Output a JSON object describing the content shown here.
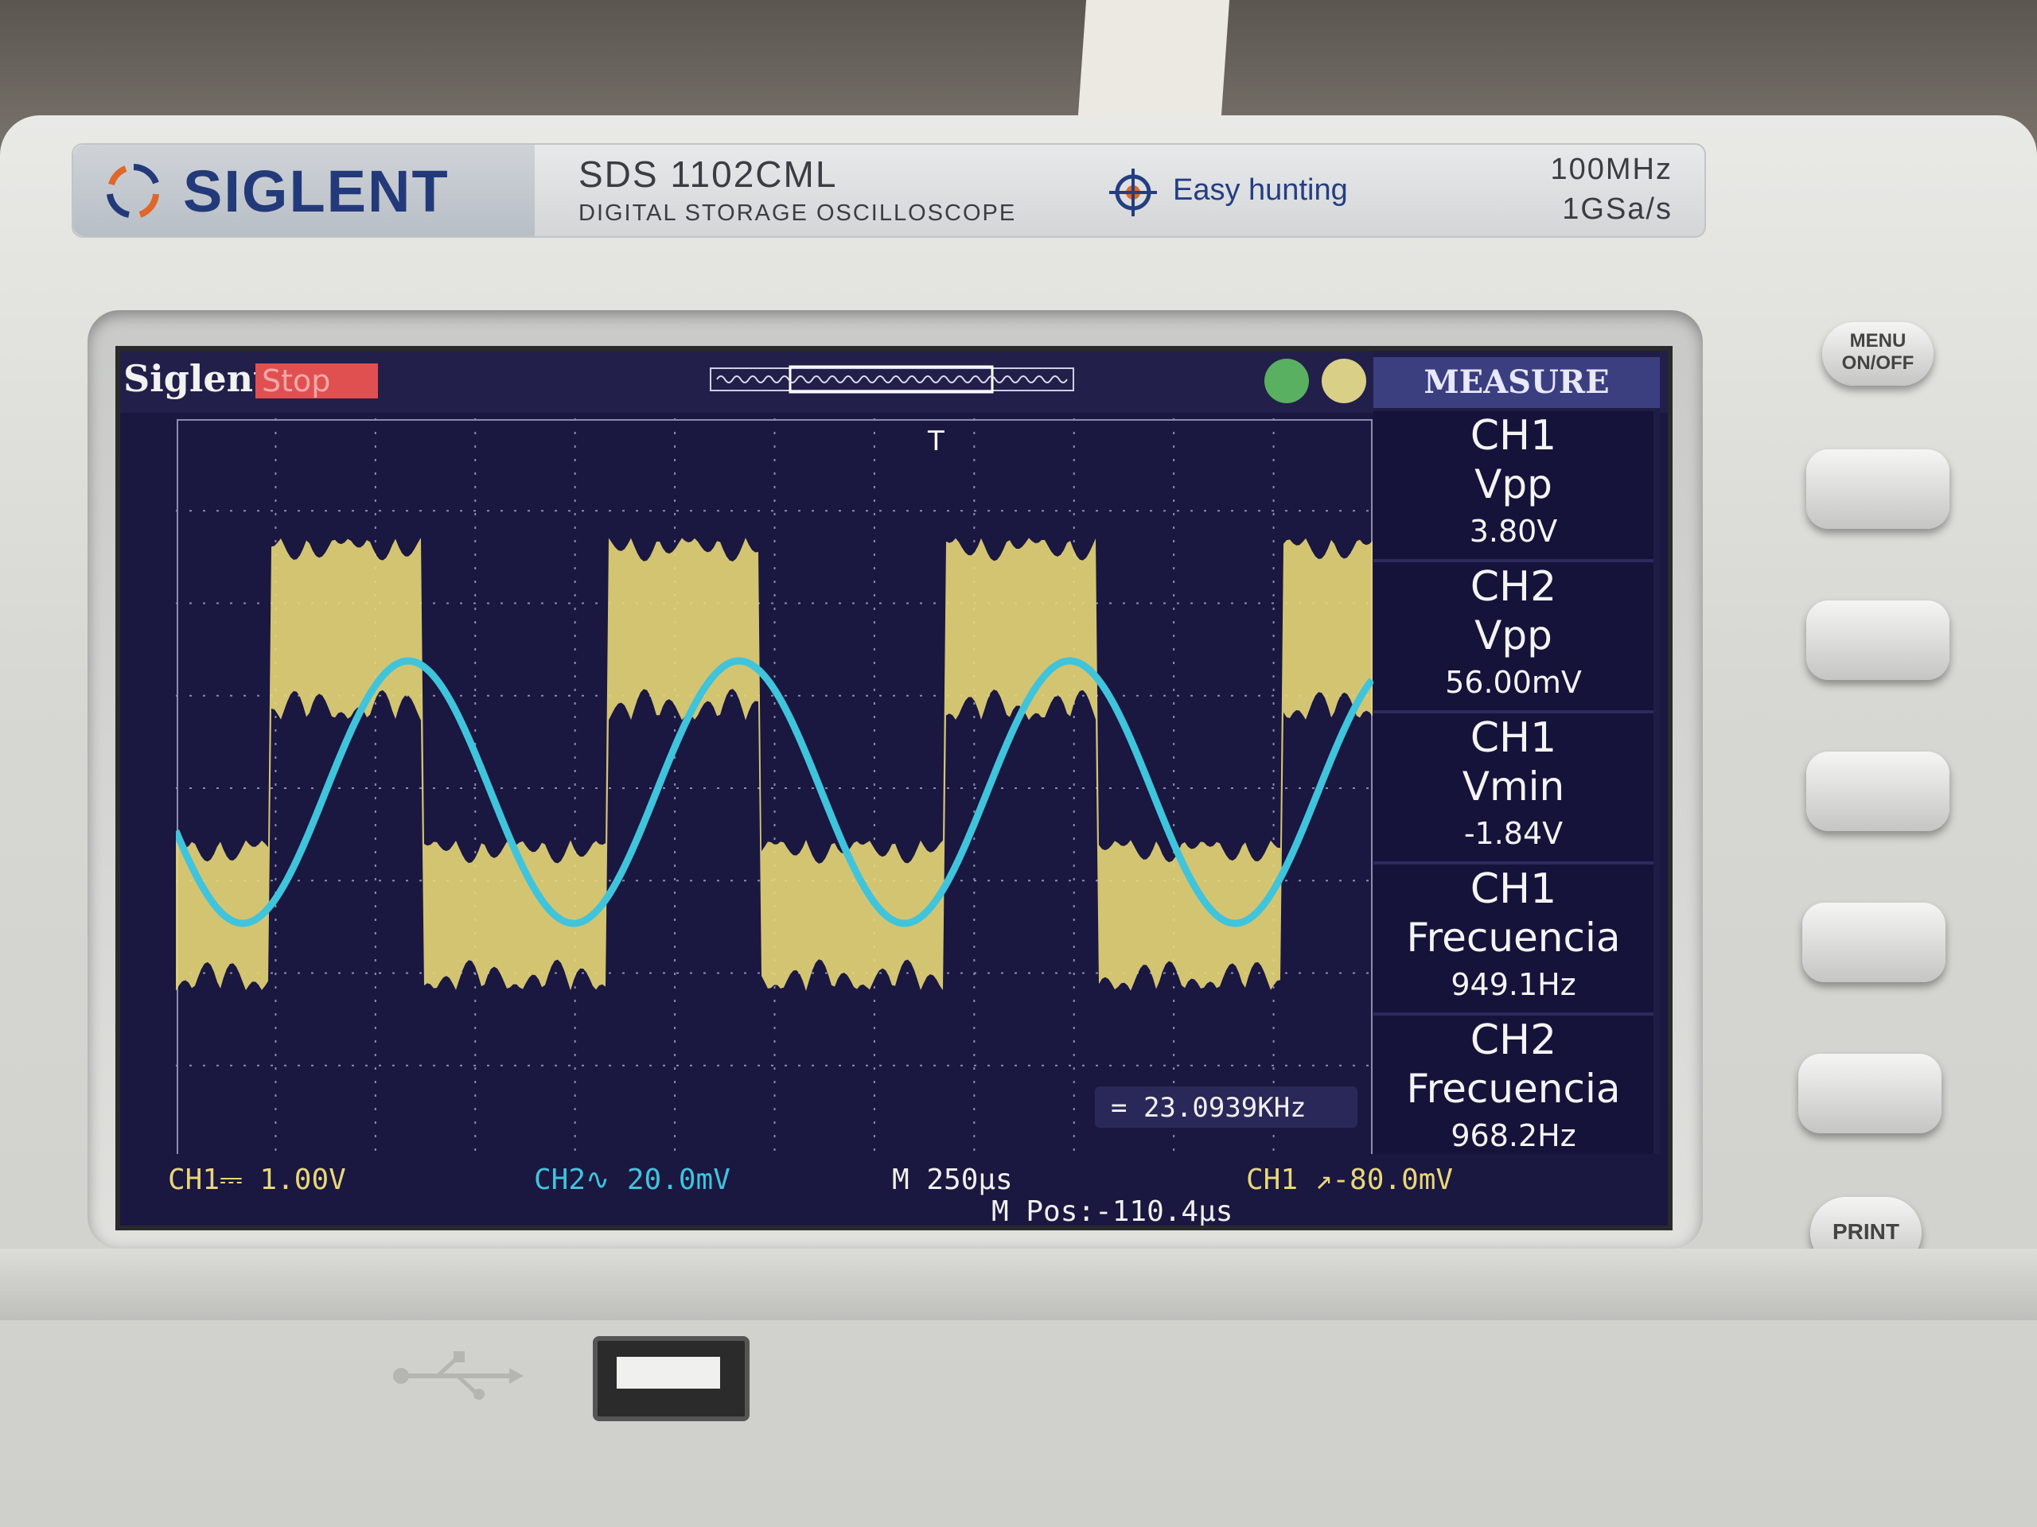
{
  "brand": "SIGLENT",
  "model": "SDS 1102CML",
  "subtitle": "DIGITAL STORAGE OSCILLOSCOPE",
  "feature": "Easy hunting",
  "spec_bandwidth": "100MHz",
  "spec_samplerate": "1GSa/s",
  "screen": {
    "brand": "Siglent",
    "run_state": "Stop",
    "measure_title": "MEASURE",
    "measurements": [
      {
        "source": "CH1",
        "type": "Vpp",
        "value": "3.80V"
      },
      {
        "source": "CH2",
        "type": "Vpp",
        "value": "56.00mV"
      },
      {
        "source": "CH1",
        "type": "Vmin",
        "value": "-1.84V"
      },
      {
        "source": "CH1",
        "type": "Frecuencia",
        "value": "949.1Hz"
      },
      {
        "source": "CH2",
        "type": "Frecuencia",
        "value": "968.2Hz"
      }
    ],
    "trigger_freq": "= 23.0939KHz",
    "ch1_scale": "CH1⎓ 1.00V",
    "ch2_scale": "CH2∿ 20.0mV",
    "timebase": "M 250µs",
    "mpos": "M Pos:-110.4µs",
    "trigger": "CH1 ↗-80.0mV",
    "trigger_marker": "T"
  },
  "colors": {
    "ch1": "#e8d778",
    "ch2": "#3fc4dc",
    "screen_bg": "#1a1740",
    "grid": "#8a8cb0"
  },
  "buttons": {
    "menu": "MENU\nON/OFF",
    "print": "PRINT"
  }
}
